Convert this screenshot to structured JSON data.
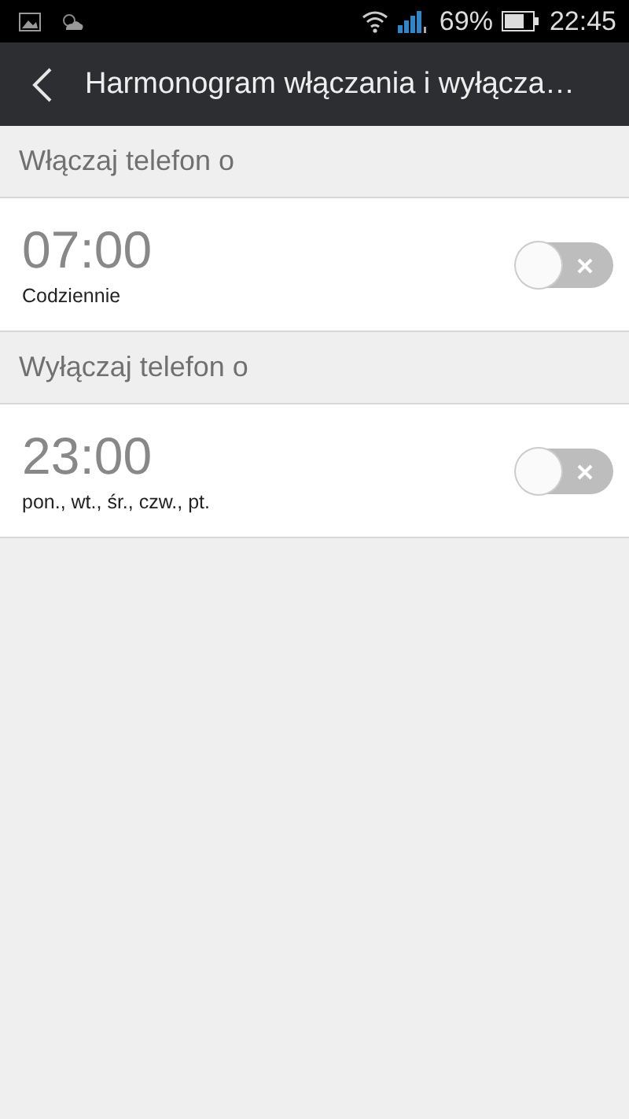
{
  "status_bar": {
    "battery_percent": "69%",
    "time": "22:45"
  },
  "app_bar": {
    "title": "Harmonogram włączania i wyłącza…"
  },
  "sections": [
    {
      "header": "Włączaj telefon o",
      "time": "07:00",
      "repeat": "Codziennie",
      "on": false
    },
    {
      "header": "Wyłączaj telefon o",
      "time": "23:00",
      "repeat": "pon., wt., śr., czw., pt.",
      "on": false
    }
  ]
}
